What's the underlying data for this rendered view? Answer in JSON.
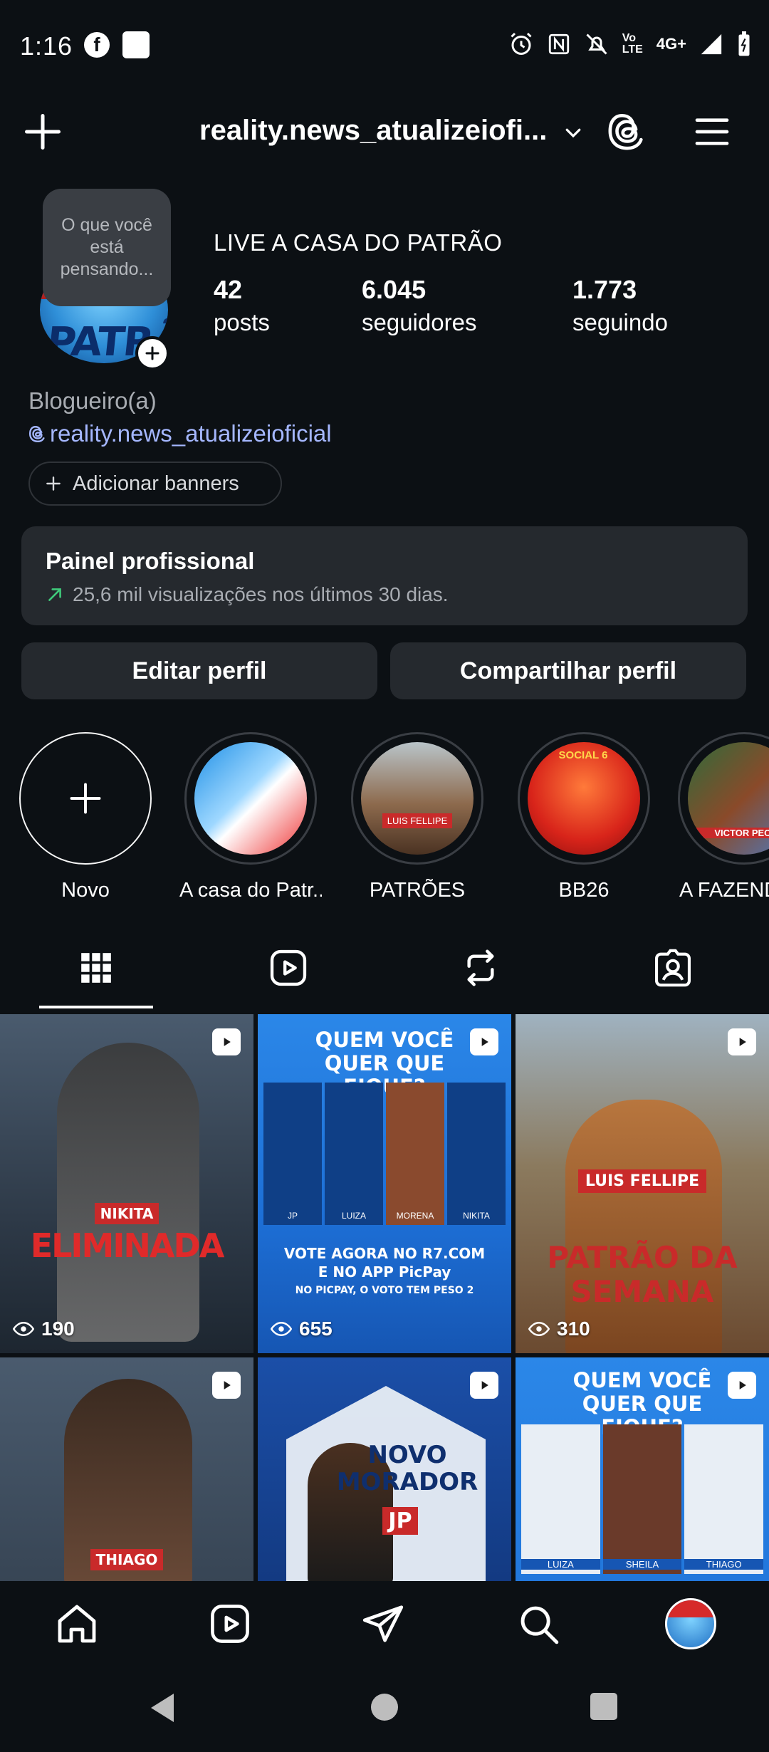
{
  "status_bar": {
    "time": "1:16",
    "net": "4G+",
    "volte": "Vo LTE",
    "icons": [
      "facebook-icon",
      "app-square-icon",
      "alarm-icon",
      "nfc-icon",
      "mute-icon",
      "signal-icon",
      "battery-icon"
    ]
  },
  "top_bar": {
    "username": "reality.news_atualizeiofi...",
    "icons": [
      "plus-icon",
      "chevron-down-icon",
      "threads-icon",
      "menu-icon"
    ]
  },
  "profile": {
    "note": "O que você está pensando...",
    "name": "LIVE A CASA DO PATRÃO",
    "stats": [
      {
        "num": "42",
        "label": "posts"
      },
      {
        "num": "6.045",
        "label": "seguidores"
      },
      {
        "num": "1.773",
        "label": "seguindo"
      }
    ],
    "category": "Blogueiro(a)",
    "threads_handle": "reality.news_atualizeioficial",
    "banners_label": "Adicionar banners"
  },
  "panel": {
    "title": "Painel profissional",
    "subtitle": "25,6 mil visualizações nos últimos 30 dias."
  },
  "buttons": {
    "edit": "Editar perfil",
    "share": "Compartilhar perfil"
  },
  "highlights": [
    {
      "label": "Novo"
    },
    {
      "label": "A casa do Patr..."
    },
    {
      "label": "PATRÕES"
    },
    {
      "label": "BB26"
    },
    {
      "label": "A FAZENDA"
    }
  ],
  "tabs": [
    "grid-icon",
    "reels-icon",
    "reposts-icon",
    "tagged-icon"
  ],
  "posts": [
    {
      "views": "190",
      "title": "ELIMINADA",
      "name": "NIKITA",
      "bg": "#3b4a5c"
    },
    {
      "views": "655",
      "title": "QUEM VOCÊ QUER QUE FIQUE?",
      "names": [
        "JP",
        "LUIZA",
        "MORENA",
        "NIKITA"
      ],
      "bg": "#1d6fd6",
      "footer": "VOTE AGORA NO R7.COM",
      "footer2": "E NO APP PicPay",
      "footer3": "NO PICPAY, O VOTO TEM PESO 2"
    },
    {
      "views": "310",
      "title": "PATRÃO DA SEMANA",
      "name": "LUIS FELLIPE",
      "bg": "#8b6a4e"
    },
    {
      "name": "THIAGO",
      "bg": "#3b4a5c"
    },
    {
      "title": "NOVO MORADOR",
      "name": "JP",
      "bg": "#1b4fa8"
    },
    {
      "title": "QUEM VOCÊ QUER QUE FIQUE?",
      "names": [
        "LUIZA",
        "SHEILA",
        "THIAGO"
      ],
      "bg": "#1d6fd6"
    }
  ],
  "highlight_texts": {
    "luis": "LUIS FELLIPE",
    "bb": "SOCIAL 6",
    "fazenda": "VICTOR PECO"
  },
  "bottom_nav": [
    "home-icon",
    "reels-icon",
    "send-icon",
    "search-icon",
    "profile-avatar"
  ],
  "system_nav": [
    "back-button",
    "home-button",
    "recents-button"
  ],
  "colors": {
    "background": "#0c1014",
    "surface": "#25292e",
    "link": "#a5b7ff",
    "accent_green": "#3fc97a"
  }
}
